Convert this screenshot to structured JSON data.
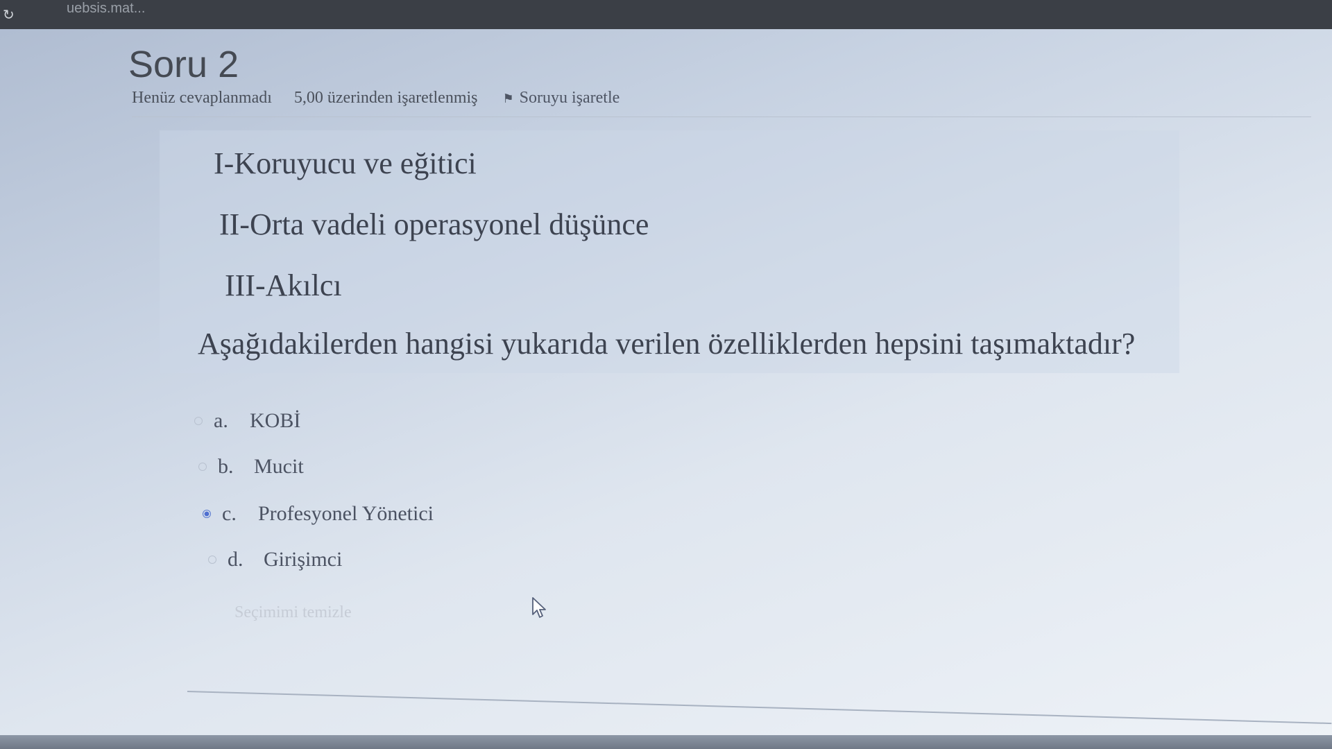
{
  "browser": {
    "url_text": "uebsis.mat...",
    "reload_icon": "reload-icon"
  },
  "question": {
    "title": "Soru 2",
    "state": "Henüz cevaplanmadı",
    "grade": "5,00 üzerinden işaretlenmiş",
    "flag_label": "Soruyu işaretle",
    "flag_icon": "flag-icon",
    "lines": [
      "I-Koruyucu ve eğitici",
      "II-Orta vadeli operasyonel düşünce",
      "III-Akılcı"
    ],
    "prompt": "Aşağıdakilerden hangisi yukarıda verilen özelliklerden hepsini taşımaktadır?"
  },
  "answers": [
    {
      "letter": "a.",
      "text": "KOBİ",
      "selected": false
    },
    {
      "letter": "b.",
      "text": "Mucit",
      "selected": false
    },
    {
      "letter": "c.",
      "text": "Profesyonel Yönetici",
      "selected": true
    },
    {
      "letter": "d.",
      "text": "Girişimci",
      "selected": false
    }
  ],
  "clear_choice": "Seçimimi temizle",
  "colors": {
    "browser_bar": "#3b3f46",
    "radio_selected": "#4f6fd0",
    "text": "#3d4350"
  }
}
